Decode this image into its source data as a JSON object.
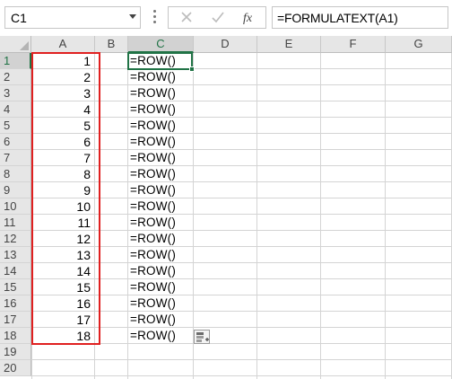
{
  "name_box": {
    "value": "C1"
  },
  "formula_bar": {
    "formula": "=FORMULATEXT(A1)",
    "fx_label": "fx",
    "cancel_icon": "close-icon",
    "enter_icon": "check-icon"
  },
  "columns": [
    "A",
    "B",
    "C",
    "D",
    "E",
    "F",
    "G"
  ],
  "active_column": "C",
  "rows": [
    "1",
    "2",
    "3",
    "4",
    "5",
    "6",
    "7",
    "8",
    "9",
    "10",
    "11",
    "12",
    "13",
    "14",
    "15",
    "16",
    "17",
    "18",
    "19",
    "20"
  ],
  "active_row": "1",
  "column_a_values": [
    "1",
    "2",
    "3",
    "4",
    "5",
    "6",
    "7",
    "8",
    "9",
    "10",
    "11",
    "12",
    "13",
    "14",
    "15",
    "16",
    "17",
    "18"
  ],
  "column_c_values": [
    "=ROW()",
    "=ROW()",
    "=ROW()",
    "=ROW()",
    "=ROW()",
    "=ROW()",
    "=ROW()",
    "=ROW()",
    "=ROW()",
    "=ROW()",
    "=ROW()",
    "=ROW()",
    "=ROW()",
    "=ROW()",
    "=ROW()",
    "=ROW()",
    "=ROW()",
    "=ROW()"
  ],
  "colors": {
    "accent_green": "#217346",
    "highlight_red": "#e02020",
    "header_bg": "#e6e6e6",
    "gridline": "#d4d4d4"
  }
}
